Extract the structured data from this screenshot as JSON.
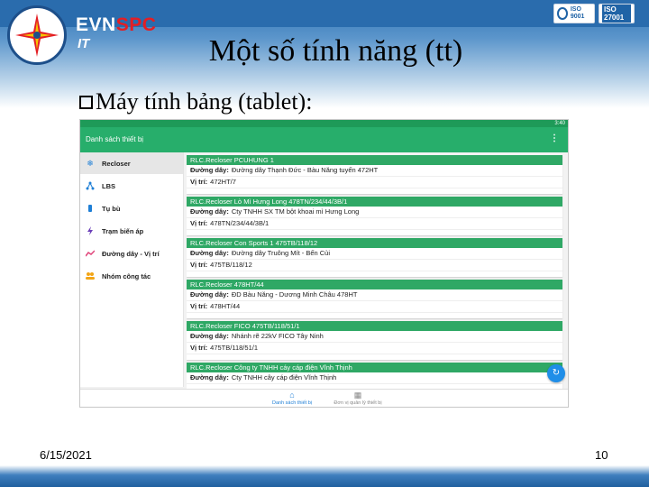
{
  "header": {
    "brand_evn": "EVN",
    "brand_spc": "SPC",
    "brand_sub": "IT",
    "iso1": "ISO 9001",
    "iso2": "ISO 27001"
  },
  "slide": {
    "title": "Một số tính năng (tt)",
    "bullet": "Máy tính bảng (tablet):",
    "date": "6/15/2021",
    "page_number": "10"
  },
  "tablet": {
    "status_time": "3:40",
    "app_title": "Danh sách thiết bị",
    "menu_icon": "more-vert-icon",
    "sidebar": [
      {
        "label": "Recloser",
        "icon": "snowflake-icon",
        "color": "#1f7fd6"
      },
      {
        "label": "LBS",
        "icon": "network-icon",
        "color": "#1f7fd6"
      },
      {
        "label": "Tụ bù",
        "icon": "battery-icon",
        "color": "#1f7fd6"
      },
      {
        "label": "Trạm biến áp",
        "icon": "lightning-icon",
        "color": "#6b3fb8"
      },
      {
        "label": "Đường dây - Vị trí",
        "icon": "trend-icon",
        "color": "#e0447a"
      },
      {
        "label": "Nhóm công tác",
        "icon": "group-icon",
        "color": "#f2a516"
      }
    ],
    "field_line": "Đường dây:",
    "field_position": "Vị trí:",
    "devices": [
      {
        "name": "RLC.Recloser PCUHUNG 1",
        "line": "Đường dây Thạnh Đức - Bàu Năng tuyến 472HT",
        "position": "472HT/7"
      },
      {
        "name": "RLC.Recloser Lò Mì Hưng Long 478TN/234/44/3B/1",
        "line": "Cty TNHH SX TM bột khoai mì Hưng Long",
        "position": "478TN/234/44/3B/1"
      },
      {
        "name": "RLC.Recloser Con Sports 1 475TB/118/12",
        "line": "Đường dây Truông Mít - Bến Củi",
        "position": "475TB/118/12"
      },
      {
        "name": "RLC.Recloser 478HT/44",
        "line": "ĐD Bàu Năng - Dương Minh Châu 478HT",
        "position": "478HT/44"
      },
      {
        "name": "RLC.Recloser FICO 475TB/118/51/1",
        "line": "Nhánh rẽ 22kV FICO Tây Ninh",
        "position": "475TB/118/51/1"
      },
      {
        "name": "RLC.Recloser Công ty TNHH cáy cáp điện Vĩnh Thịnh",
        "line": "Cty TNHH cây cáp điện Vĩnh Thịnh",
        "position": ""
      }
    ],
    "bottom_nav": [
      {
        "label": "Danh sách thiết bị",
        "icon": "home-icon"
      },
      {
        "label": "Đơn vị quản lý thiết bị",
        "icon": "grid-icon"
      }
    ],
    "fab_icon": "refresh-icon"
  }
}
